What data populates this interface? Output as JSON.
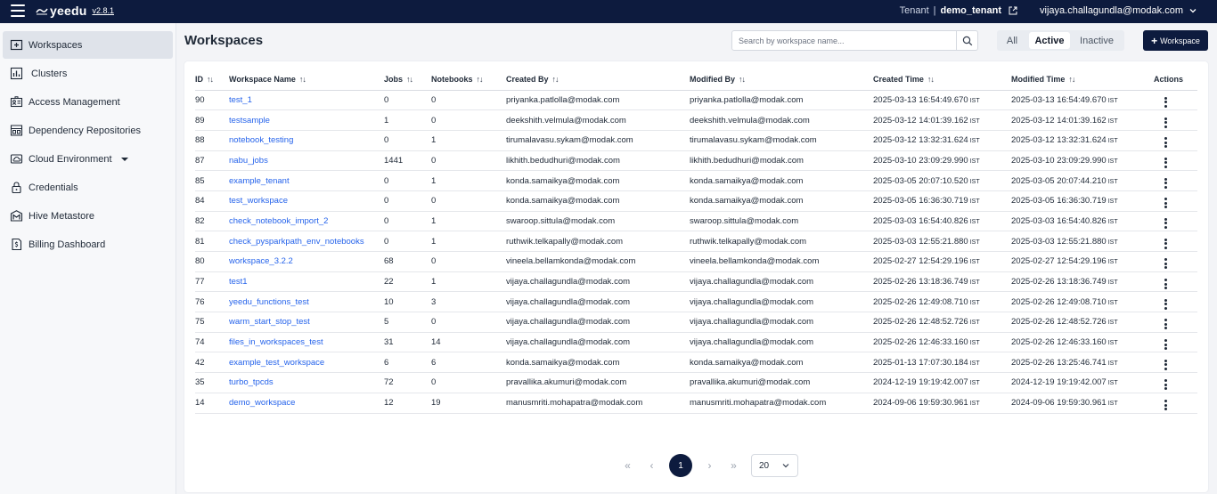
{
  "app": {
    "brand": "yeedu",
    "version": "v2.8.1",
    "tenant_label": "Tenant",
    "tenant_separator": "|",
    "tenant_name": "demo_tenant",
    "user_email": "vijaya.challagundla@modak.com"
  },
  "sidebar": {
    "items": [
      {
        "label": "Workspaces",
        "icon": "workspace-icon"
      },
      {
        "label": "Clusters",
        "icon": "cluster-icon"
      },
      {
        "label": "Access Management",
        "icon": "access-icon"
      },
      {
        "label": "Dependency Repositories",
        "icon": "repository-icon"
      },
      {
        "label": "Cloud Environment",
        "icon": "cloud-icon"
      },
      {
        "label": "Credentials",
        "icon": "lock-icon"
      },
      {
        "label": "Hive Metastore",
        "icon": "hive-icon"
      },
      {
        "label": "Billing Dashboard",
        "icon": "billing-icon"
      }
    ]
  },
  "page": {
    "title": "Workspaces",
    "search_placeholder": "Search by workspace name...",
    "filters": [
      "All",
      "Active",
      "Inactive"
    ],
    "active_filter": "Active",
    "new_button": "Workspace"
  },
  "table": {
    "headers": [
      "ID",
      "Workspace Name",
      "Jobs",
      "Notebooks",
      "Created By",
      "Modified By",
      "Created Time",
      "Modified Time",
      "Actions"
    ],
    "sort_glyph": "↑↓",
    "timezone": "IST",
    "rows": [
      [
        "90",
        "test_1",
        "0",
        "0",
        "priyanka.patlolla@modak.com",
        "priyanka.patlolla@modak.com",
        "2025-03-13 16:54:49.670",
        "2025-03-13 16:54:49.670"
      ],
      [
        "89",
        "testsample",
        "1",
        "0",
        "deekshith.velmula@modak.com",
        "deekshith.velmula@modak.com",
        "2025-03-12 14:01:39.162",
        "2025-03-12 14:01:39.162"
      ],
      [
        "88",
        "notebook_testing",
        "0",
        "1",
        "tirumalavasu.sykam@modak.com",
        "tirumalavasu.sykam@modak.com",
        "2025-03-12 13:32:31.624",
        "2025-03-12 13:32:31.624"
      ],
      [
        "87",
        "nabu_jobs",
        "1441",
        "0",
        "likhith.bedudhuri@modak.com",
        "likhith.bedudhuri@modak.com",
        "2025-03-10 23:09:29.990",
        "2025-03-10 23:09:29.990"
      ],
      [
        "85",
        "example_tenant",
        "0",
        "1",
        "konda.samaikya@modak.com",
        "konda.samaikya@modak.com",
        "2025-03-05 20:07:10.520",
        "2025-03-05 20:07:44.210"
      ],
      [
        "84",
        "test_workspace",
        "0",
        "0",
        "konda.samaikya@modak.com",
        "konda.samaikya@modak.com",
        "2025-03-05 16:36:30.719",
        "2025-03-05 16:36:30.719"
      ],
      [
        "82",
        "check_notebook_import_2",
        "0",
        "1",
        "swaroop.sittula@modak.com",
        "swaroop.sittula@modak.com",
        "2025-03-03 16:54:40.826",
        "2025-03-03 16:54:40.826"
      ],
      [
        "81",
        "check_pysparkpath_env_notebooks",
        "0",
        "1",
        "ruthwik.telkapally@modak.com",
        "ruthwik.telkapally@modak.com",
        "2025-03-03 12:55:21.880",
        "2025-03-03 12:55:21.880"
      ],
      [
        "80",
        "workspace_3.2.2",
        "68",
        "0",
        "vineela.bellamkonda@modak.com",
        "vineela.bellamkonda@modak.com",
        "2025-02-27 12:54:29.196",
        "2025-02-27 12:54:29.196"
      ],
      [
        "77",
        "test1",
        "22",
        "1",
        "vijaya.challagundla@modak.com",
        "vijaya.challagundla@modak.com",
        "2025-02-26 13:18:36.749",
        "2025-02-26 13:18:36.749"
      ],
      [
        "76",
        "yeedu_functions_test",
        "10",
        "3",
        "vijaya.challagundla@modak.com",
        "vijaya.challagundla@modak.com",
        "2025-02-26 12:49:08.710",
        "2025-02-26 12:49:08.710"
      ],
      [
        "75",
        "warm_start_stop_test",
        "5",
        "0",
        "vijaya.challagundla@modak.com",
        "vijaya.challagundla@modak.com",
        "2025-02-26 12:48:52.726",
        "2025-02-26 12:48:52.726"
      ],
      [
        "74",
        "files_in_workspaces_test",
        "31",
        "14",
        "vijaya.challagundla@modak.com",
        "vijaya.challagundla@modak.com",
        "2025-02-26 12:46:33.160",
        "2025-02-26 12:46:33.160"
      ],
      [
        "42",
        "example_test_workspace",
        "6",
        "6",
        "konda.samaikya@modak.com",
        "konda.samaikya@modak.com",
        "2025-01-13 17:07:30.184",
        "2025-02-26 13:25:46.741"
      ],
      [
        "35",
        "turbo_tpcds",
        "72",
        "0",
        "pravallika.akumuri@modak.com",
        "pravallika.akumuri@modak.com",
        "2024-12-19 19:19:42.007",
        "2024-12-19 19:19:42.007"
      ],
      [
        "14",
        "demo_workspace",
        "12",
        "19",
        "manusmriti.mohapatra@modak.com",
        "manusmriti.mohapatra@modak.com",
        "2024-09-06 19:59:30.961",
        "2024-09-06 19:59:30.961"
      ]
    ]
  },
  "pagination": {
    "first": "«",
    "prev": "‹",
    "current_page": "1",
    "next": "›",
    "last": "»",
    "page_size": "20"
  }
}
